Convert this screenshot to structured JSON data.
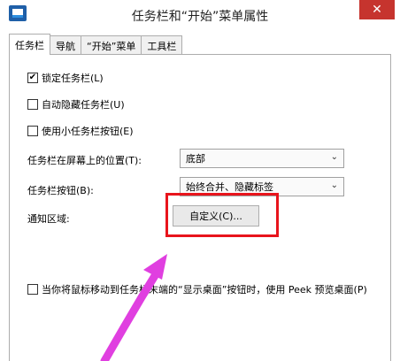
{
  "window": {
    "title": "任务栏和“开始”菜单属性",
    "close_glyph": "✕"
  },
  "tabs": [
    {
      "label": "任务栏",
      "active": true
    },
    {
      "label": "导航",
      "active": false
    },
    {
      "label": "“开始”菜单",
      "active": false
    },
    {
      "label": "工具栏",
      "active": false
    }
  ],
  "options": {
    "lock_taskbar": {
      "label": "锁定任务栏(L)",
      "checked": true
    },
    "auto_hide": {
      "label": "自动隐藏任务栏(U)",
      "checked": false
    },
    "small_buttons": {
      "label": "使用小任务栏按钮(E)",
      "checked": false
    }
  },
  "position": {
    "label": "任务栏在屏幕上的位置(T):",
    "value": "底部"
  },
  "buttons_setting": {
    "label": "任务栏按钮(B):",
    "value": "始终合并、隐藏标签"
  },
  "notification": {
    "label": "通知区域:",
    "customize_label": "自定义(C)..."
  },
  "peek": {
    "label": "当你将鼠标移动到任务栏末端的“显示桌面”按钮时，使用 Peek 预览桌面(P)",
    "checked": false
  },
  "annotation": {
    "highlight_color": "#e8141c",
    "arrow_color": "#e03fe0"
  },
  "colors": {
    "close_button": "#c6342e"
  }
}
